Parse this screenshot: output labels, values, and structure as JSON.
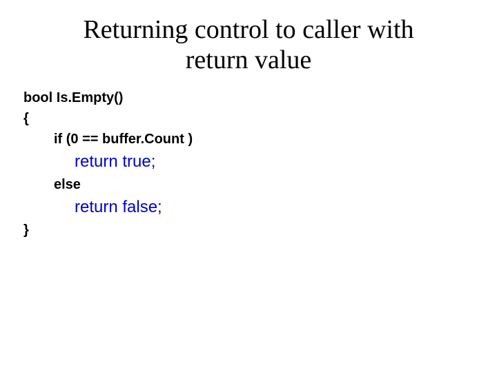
{
  "title_line1": "Returning control to caller with",
  "title_line2": "return value",
  "code": {
    "l1": "bool Is.Empty()",
    "l2": "{",
    "l3": "if (0 == buffer.Count )",
    "l4": "return true;",
    "l5": "else",
    "l6": "return false;",
    "l7": "}"
  }
}
